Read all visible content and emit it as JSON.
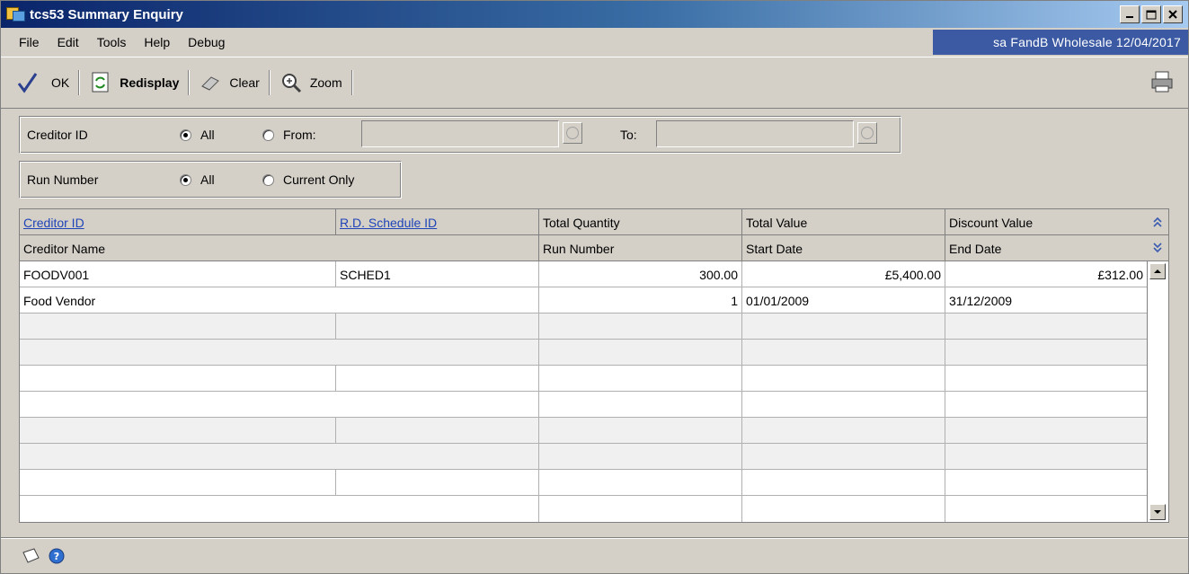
{
  "window": {
    "title": "tcs53 Summary Enquiry"
  },
  "menu": [
    "File",
    "Edit",
    "Tools",
    "Help",
    "Debug"
  ],
  "status": "sa  FandB Wholesale  12/04/2017",
  "toolbar": {
    "ok": "OK",
    "redisplay": "Redisplay",
    "clear": "Clear",
    "zoom": "Zoom"
  },
  "filters": {
    "creditor": {
      "label": "Creditor ID",
      "all": "All",
      "from": "From:",
      "to": "To:"
    },
    "run": {
      "label": "Run Number",
      "all": "All",
      "current": "Current Only"
    }
  },
  "grid": {
    "header1": [
      "Creditor ID",
      "R.D. Schedule ID",
      "Total Quantity",
      "Total Value",
      "Discount Value"
    ],
    "header2": [
      "Creditor Name",
      "",
      "Run Number",
      "Start Date",
      "End Date"
    ],
    "row1": [
      "FOODV001",
      "SCHED1",
      "300.00",
      "£5,400.00",
      "£312.00"
    ],
    "row2": [
      "Food Vendor",
      "1",
      "01/01/2009",
      "31/12/2009"
    ]
  },
  "icons": {
    "ok": "checkmark-icon",
    "redisplay": "refresh-icon",
    "clear": "eraser-icon",
    "zoom": "magnifier-icon",
    "print": "printer-icon",
    "note": "note-icon",
    "help": "help-icon"
  }
}
